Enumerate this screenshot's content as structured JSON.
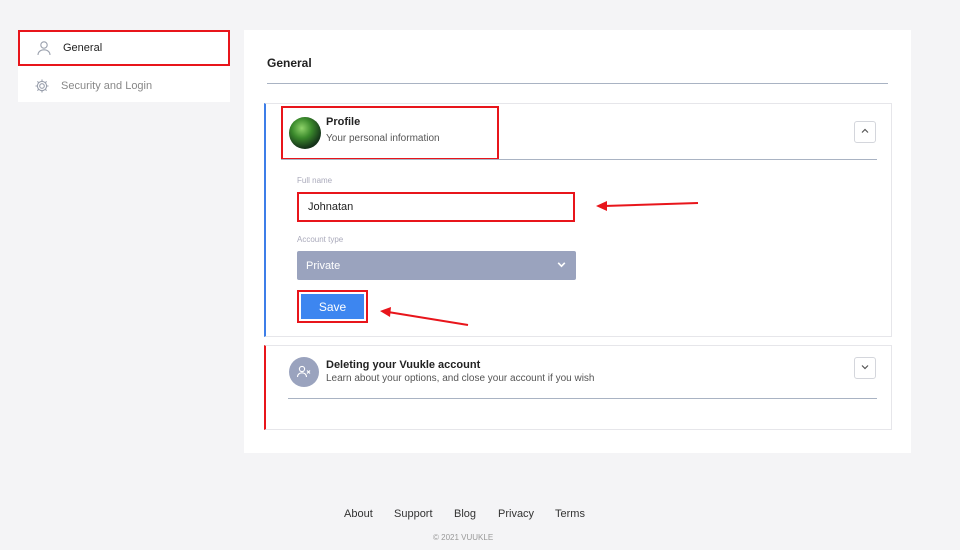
{
  "sidebar": {
    "items": [
      {
        "label": "General",
        "icon": "user-icon"
      },
      {
        "label": "Security and Login",
        "icon": "gear-icon"
      }
    ]
  },
  "main": {
    "title": "General",
    "profile": {
      "title": "Profile",
      "subtitle": "Your personal information",
      "full_name_label": "Full name",
      "full_name_value": "Johnatan",
      "account_type_label": "Account type",
      "account_type_value": "Private",
      "save_label": "Save"
    },
    "delete": {
      "title": "Deleting your Vuukle account",
      "subtitle": "Learn about your options, and close your account if you wish"
    }
  },
  "footer": {
    "links": [
      "About",
      "Support",
      "Blog",
      "Privacy",
      "Terms"
    ],
    "copyright": "© 2021 VUUKLE"
  },
  "colors": {
    "highlight": "#e8151b",
    "accent": "#3d86f0",
    "select_bg": "#9aa3be"
  }
}
